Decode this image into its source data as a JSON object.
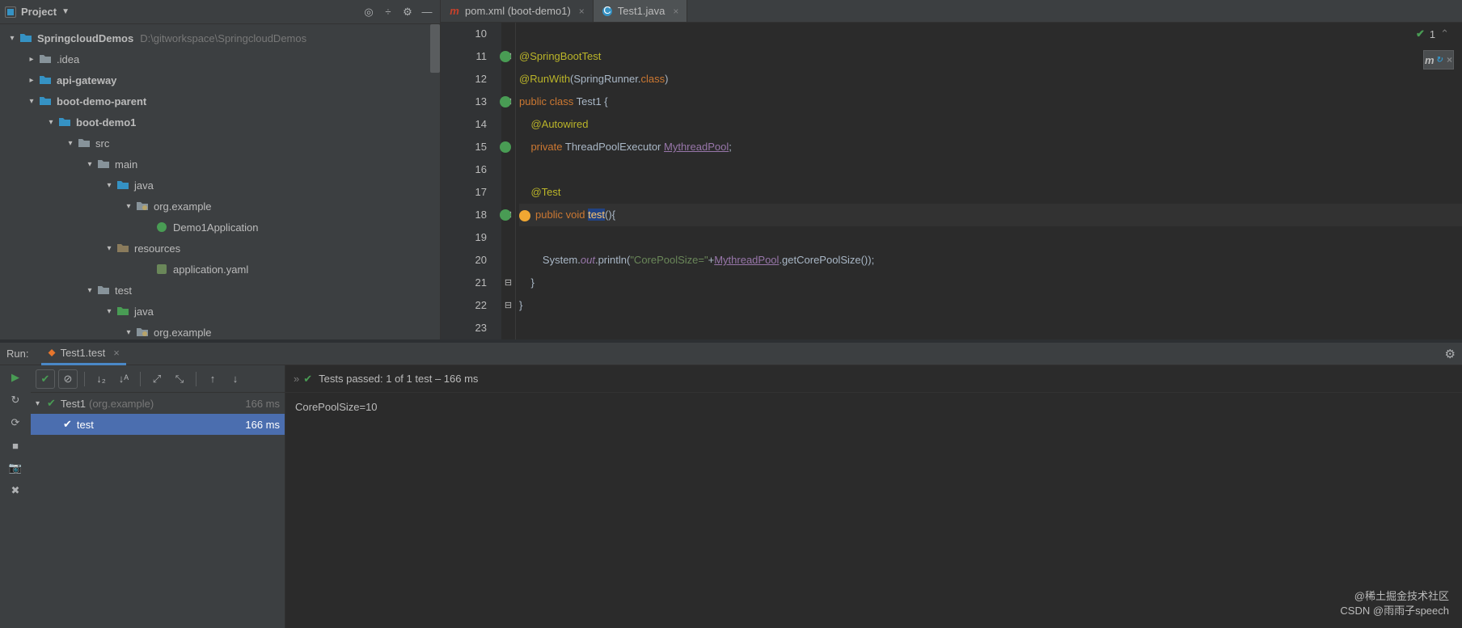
{
  "project": {
    "header": "Project",
    "root": {
      "name": "SpringcloudDemos",
      "path": "D:\\gitworkspace\\SpringcloudDemos"
    },
    "nodes": {
      "idea": ".idea",
      "api": "api-gateway",
      "parent": "boot-demo-parent",
      "demo1": "boot-demo1",
      "src": "src",
      "main": "main",
      "java1": "java",
      "pkg1": "org.example",
      "app": "Demo1Application",
      "res": "resources",
      "yaml": "application.yaml",
      "test": "test",
      "java2": "java",
      "pkg2": "org.example"
    }
  },
  "tabs": [
    {
      "icon": "m",
      "label": "pom.xml (boot-demo1)",
      "active": false
    },
    {
      "icon": "c",
      "label": "Test1.java",
      "active": true
    }
  ],
  "code": {
    "lines": [
      10,
      11,
      12,
      13,
      14,
      15,
      16,
      17,
      18,
      19,
      20,
      21,
      22,
      23
    ],
    "l11": {
      "an": "@SpringBootTest"
    },
    "l12": {
      "an": "@RunWith",
      "p1": "(SpringRunner.",
      "k": "class",
      "p2": ")"
    },
    "l13": {
      "k1": "public",
      "k2": "class",
      "name": "Test1",
      "b": " {"
    },
    "l14": {
      "an": "@Autowired"
    },
    "l15": {
      "k": "private",
      "ty": "ThreadPoolExecutor",
      "var": "MythreadPool",
      "s": ";"
    },
    "l17": {
      "an": "@Test"
    },
    "l18": {
      "k1": "public",
      "k2": "void",
      "fn": "test",
      "p": "(){"
    },
    "l20": {
      "p1": "System.",
      "fi": "out",
      "p2": ".println(",
      "st": "\"CorePoolSize=\"",
      "p3": "+",
      "var": "MythreadPool",
      "p4": ".getCorePoolSize());"
    },
    "l21": "}",
    "l22": "}"
  },
  "status": {
    "problems": "1"
  },
  "run": {
    "title": "Run:",
    "tab": "Test1.test",
    "summary": {
      "passed": "Tests passed: 1",
      "rest": " of 1 test – 166 ms"
    },
    "tree": [
      {
        "name": "Test1",
        "pkg": "(org.example)",
        "time": "166 ms",
        "sel": false,
        "exp": true
      },
      {
        "name": "test",
        "pkg": "",
        "time": "166 ms",
        "sel": true,
        "exp": false
      }
    ],
    "console": "CorePoolSize=10"
  },
  "watermark": {
    "l1": "@稀土掘金技术社区",
    "l2": "CSDN @雨雨子speech"
  }
}
